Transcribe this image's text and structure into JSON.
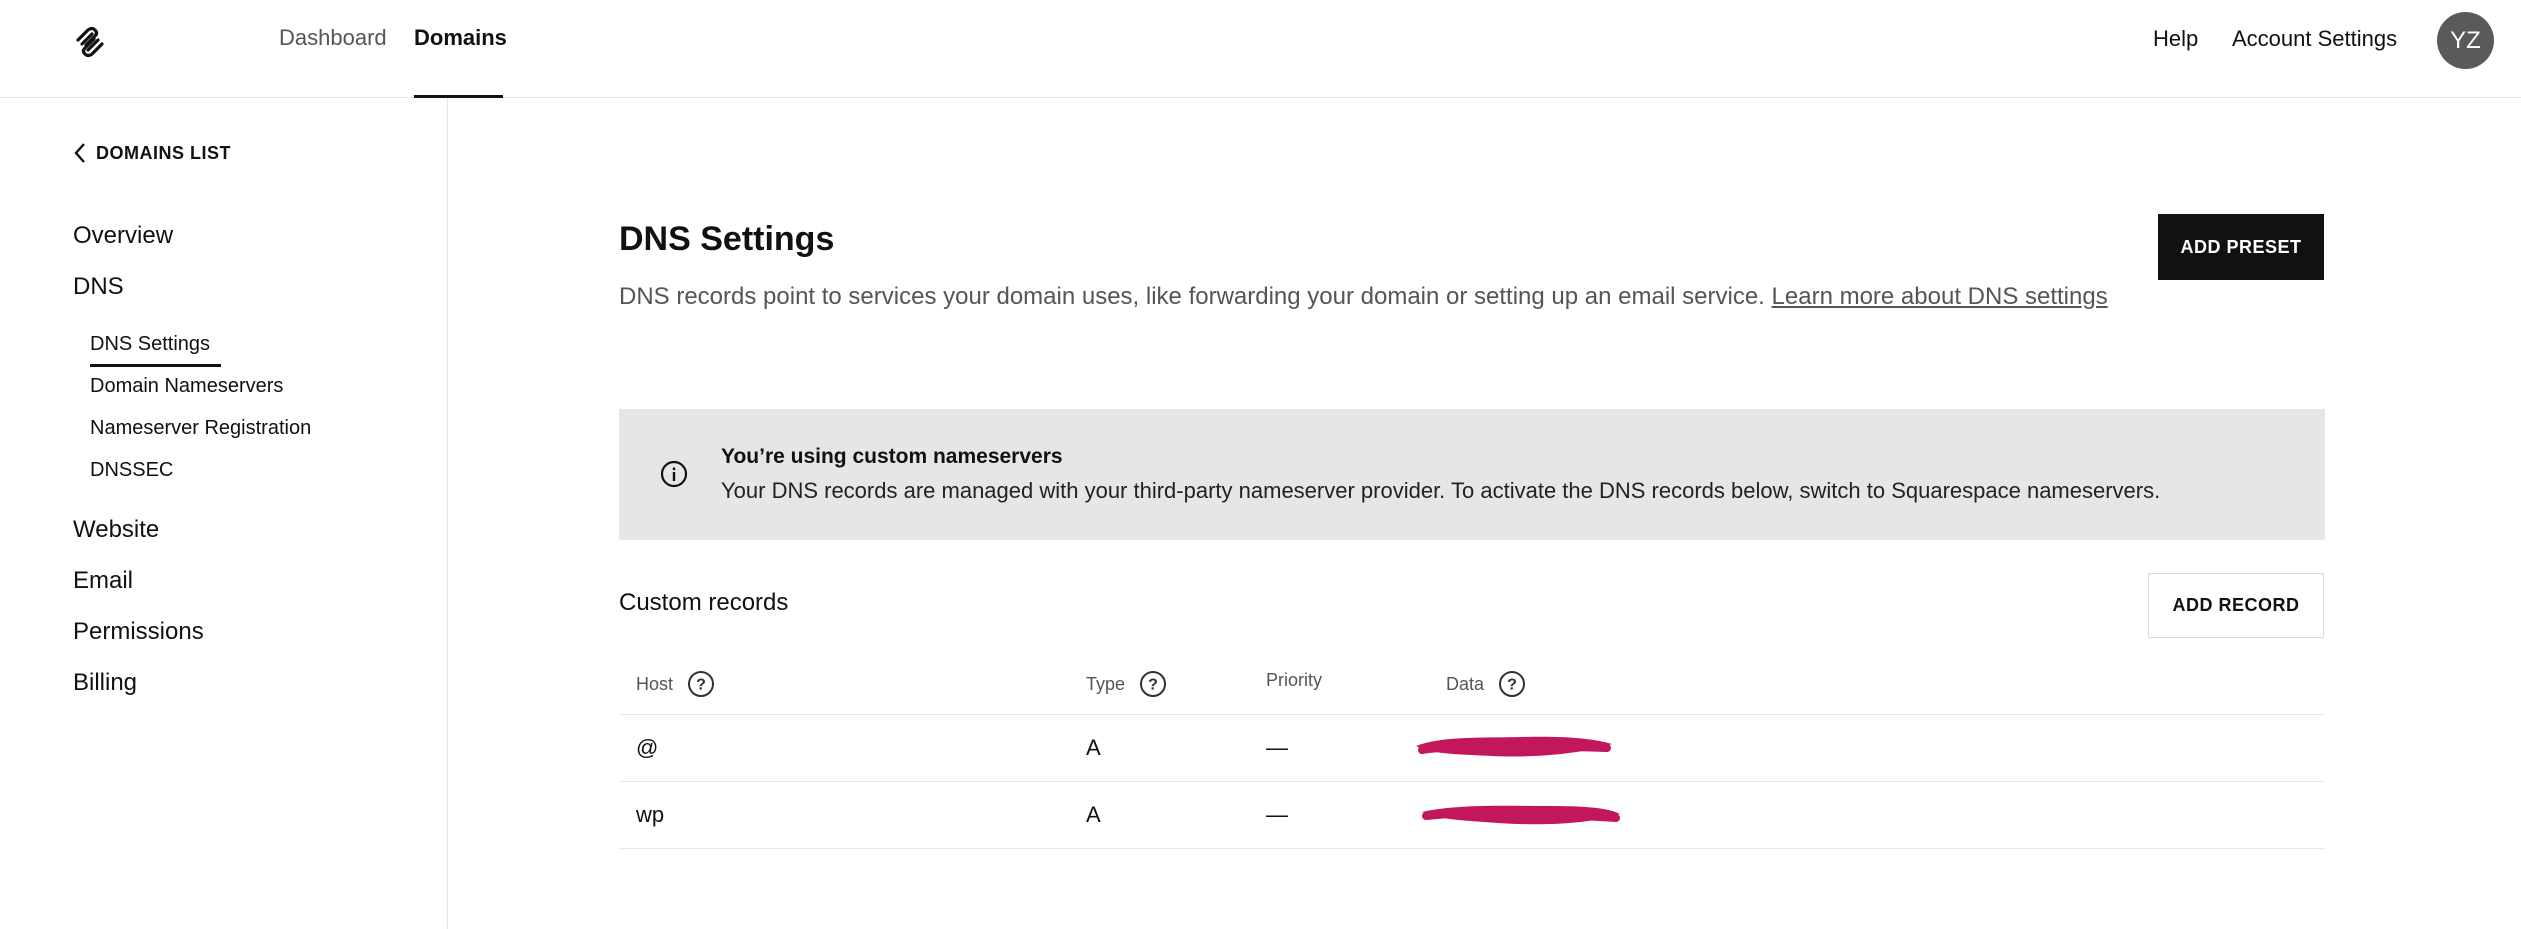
{
  "header": {
    "nav": [
      "Dashboard",
      "Domains"
    ],
    "active_nav": "Domains",
    "help": "Help",
    "account": "Account Settings",
    "avatar_initials": "YZ"
  },
  "sidebar": {
    "back_label": "DOMAINS LIST",
    "items": [
      {
        "label": "Overview"
      },
      {
        "label": "DNS"
      },
      {
        "label": "Website"
      },
      {
        "label": "Email"
      },
      {
        "label": "Permissions"
      },
      {
        "label": "Billing"
      }
    ],
    "dns_subitems": [
      {
        "label": "DNS Settings"
      },
      {
        "label": "Domain Nameservers"
      },
      {
        "label": "Nameserver Registration"
      },
      {
        "label": "DNSSEC"
      }
    ],
    "active_subitem": "DNS Settings"
  },
  "main": {
    "title": "DNS Settings",
    "description": "DNS records point to services your domain uses, like forwarding your domain or setting up an email service.",
    "learn_more": "Learn more about DNS settings",
    "add_preset": "ADD PRESET",
    "notice": {
      "title": "You’re using custom nameservers",
      "body": "Your DNS records are managed with your third-party nameserver provider. To activate the DNS records below, switch to Squarespace nameservers."
    },
    "custom_records": {
      "title": "Custom records",
      "add_record": "ADD RECORD",
      "columns": [
        "Host",
        "Type",
        "Priority",
        "Data"
      ],
      "rows": [
        {
          "host": "@",
          "type": "A",
          "priority": "—",
          "data": ""
        },
        {
          "host": "wp",
          "type": "A",
          "priority": "—",
          "data": ""
        }
      ]
    }
  },
  "colors": {
    "accent": "#111111",
    "notice_bg": "#e6e6e6",
    "redaction": "#c2185b"
  }
}
